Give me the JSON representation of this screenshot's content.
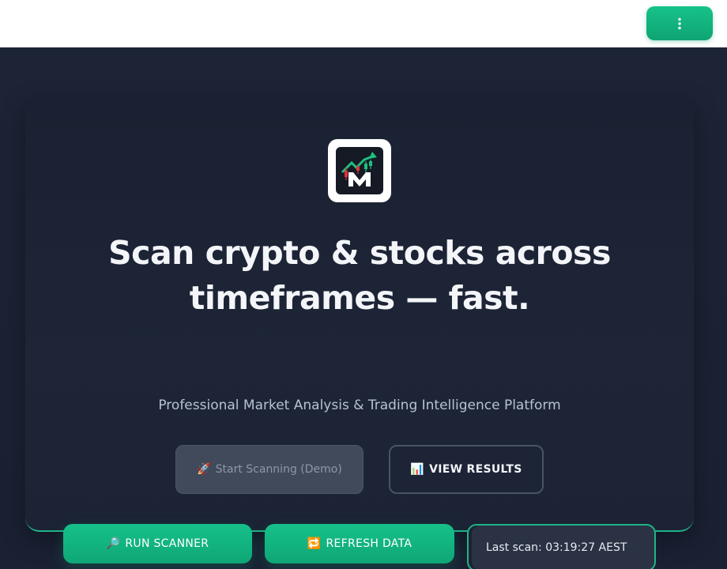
{
  "topbar": {
    "menu_icon": "kebab-menu-icon"
  },
  "hero": {
    "logo_icon": "market-scanner-logo",
    "headline": "Scan crypto & stocks across timeframes — fast.",
    "subtitle": "Professional Market Analysis & Trading Intelligence Platform",
    "start_button": {
      "icon": "🚀",
      "label": "Start Scanning (Demo)"
    },
    "view_button": {
      "icon": "📊",
      "label": "VIEW RESULTS"
    }
  },
  "actions": {
    "run_scanner": {
      "icon": "🔎",
      "label": "RUN SCANNER"
    },
    "refresh_data": {
      "icon": "🔁",
      "label": "REFRESH DATA"
    },
    "last_scan": "Last scan: 03:19:27 AEST"
  },
  "colors": {
    "accent": "#16c18a",
    "background": "#1b2233",
    "card": "#1d2537",
    "disabled_button": "#414a5b"
  }
}
